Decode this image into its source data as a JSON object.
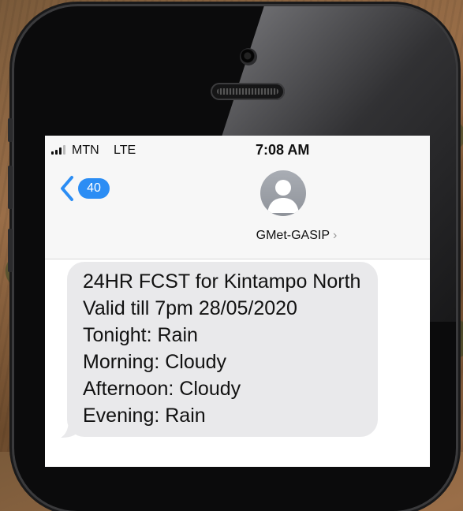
{
  "status_bar": {
    "carrier": "MTN",
    "network": "LTE",
    "time": "7:08 AM"
  },
  "header": {
    "back_count": "40",
    "contact_name": "GMet-GASIP",
    "contact_chevron": "›"
  },
  "message": {
    "lines": [
      "24HR FCST for Kintampo North",
      "Valid till 7pm 28/05/2020",
      "Tonight: Rain",
      "Morning: Cloudy",
      "Afternoon: Cloudy",
      "Evening: Rain"
    ]
  },
  "icons": {
    "signal": "signal-bars-icon",
    "back": "chevron-left-icon",
    "avatar": "person-silhouette-icon"
  },
  "colors": {
    "accent": "#2b8df4",
    "bubble": "#e9e9eb",
    "screen_bg": "#f7f7f7"
  }
}
